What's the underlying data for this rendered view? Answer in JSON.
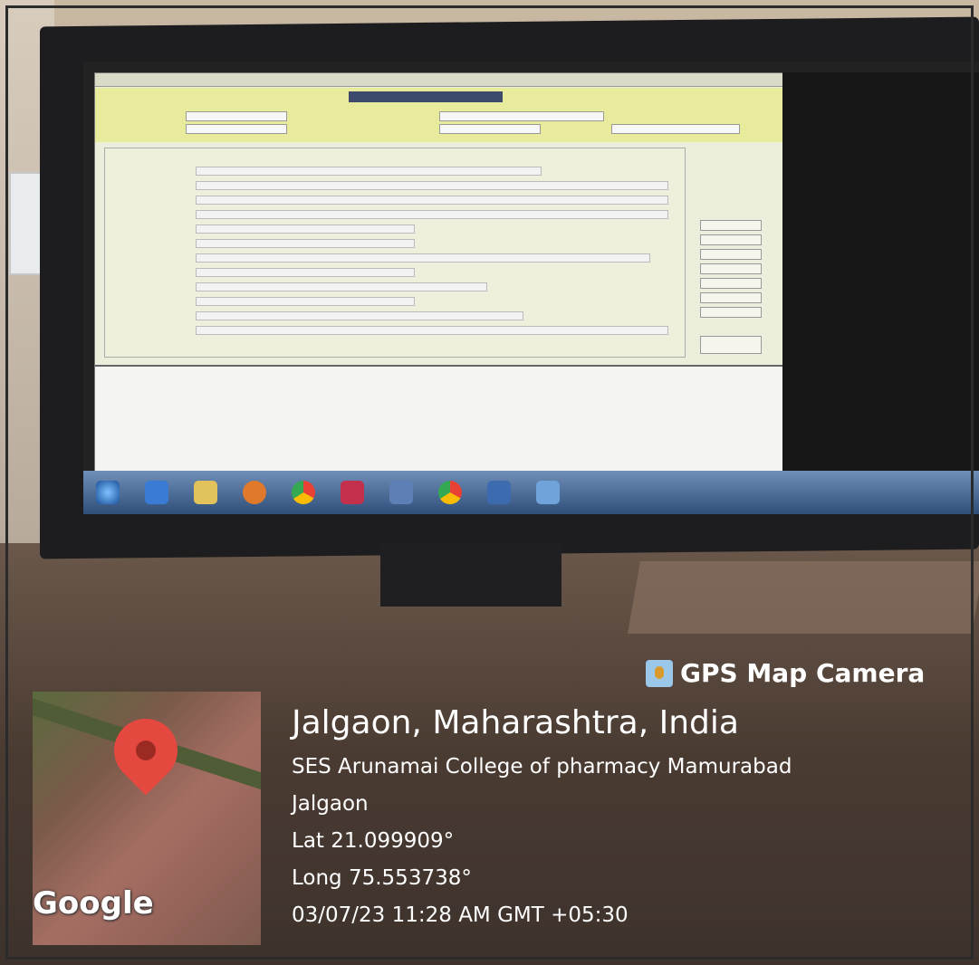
{
  "overlay": {
    "app_name": "GPS Map Camera",
    "city": "Jalgaon, Maharashtra, India",
    "address_line1": "SES Arunamai College of pharmacy Mamurabad",
    "address_line2": "Jalgaon",
    "latitude": "Lat 21.099909°",
    "longitude": "Long 75.553738°",
    "datetime": "03/07/23 11:28 AM GMT +05:30",
    "map_brand": "Google"
  }
}
